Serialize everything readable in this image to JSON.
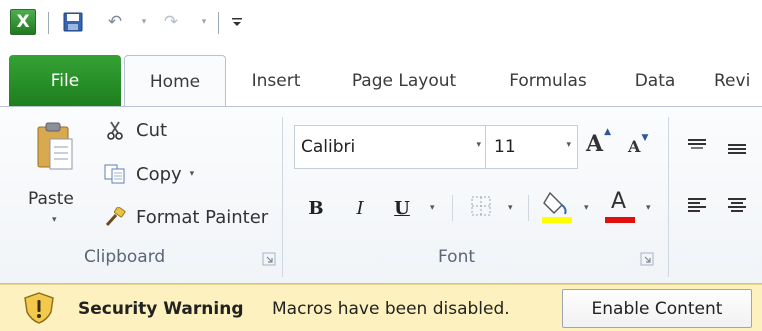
{
  "qat": {
    "logo_letter": "X",
    "icons": [
      "excel-logo-icon",
      "save-icon",
      "undo-icon",
      "redo-icon",
      "customize-icon"
    ]
  },
  "tabs": [
    {
      "label": "File"
    },
    {
      "label": "Home"
    },
    {
      "label": "Insert"
    },
    {
      "label": "Page Layout"
    },
    {
      "label": "Formulas"
    },
    {
      "label": "Data"
    },
    {
      "label": "Revi"
    }
  ],
  "clipboard": {
    "paste_label": "Paste",
    "cut_label": "Cut",
    "copy_label": "Copy",
    "format_painter_label": "Format Painter",
    "group_label": "Clipboard"
  },
  "font": {
    "name_value": "Calibri",
    "size_value": "11",
    "grow_glyph": "A",
    "shrink_glyph": "A",
    "bold_glyph": "B",
    "italic_glyph": "I",
    "underline_glyph": "U",
    "font_color_glyph": "A",
    "group_label": "Font",
    "fill_color": "#ffff00",
    "font_color": "#e01010"
  },
  "message_bar": {
    "title": "Security Warning",
    "message": "Macros have been disabled.",
    "button_label": "Enable Content"
  },
  "colors": {
    "file_tab": "#2a8f2a",
    "message_bar_bg": "#fdf2bf"
  }
}
